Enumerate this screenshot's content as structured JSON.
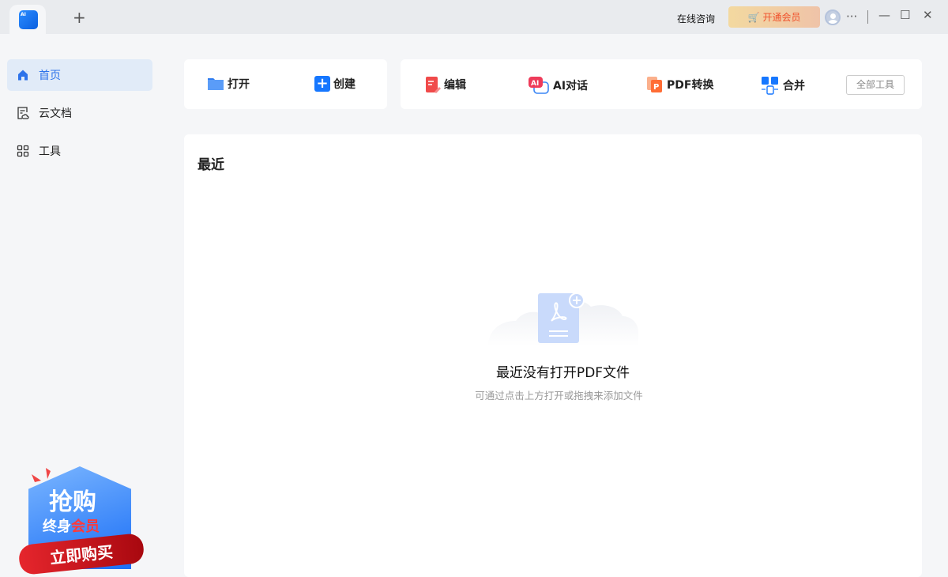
{
  "titlebar": {
    "logo_text": "AI",
    "new_tab": "+",
    "consult": "在线咨询",
    "vip_button": "开通会员",
    "more": "···",
    "minimize": "—",
    "maximize": "☐",
    "close": "✕"
  },
  "sidebar": {
    "items": [
      {
        "label": "首页",
        "icon": "home-icon",
        "active": true
      },
      {
        "label": "云文档",
        "icon": "cloud-doc-icon"
      },
      {
        "label": "工具",
        "icon": "grid-icon"
      }
    ],
    "promo": {
      "line1": "抢购",
      "line2a": "终身",
      "line2b": "会员",
      "button": "立即购买"
    }
  },
  "toolbar": {
    "open": "打开",
    "create": "创建",
    "edit": "编辑",
    "ai_chat": "AI对话",
    "pdf_convert": "PDF转换",
    "merge": "合并",
    "all_tools": "全部工具"
  },
  "recent": {
    "title": "最近",
    "empty_title": "最近没有打开PDF文件",
    "empty_hint": "可通过点击上方打开或拖拽来添加文件"
  },
  "colors": {
    "accent": "#2e73ea",
    "vip_text": "#f0502a",
    "edit_icon": "#f04a4a",
    "convert_icon": "#ff7a3d"
  }
}
